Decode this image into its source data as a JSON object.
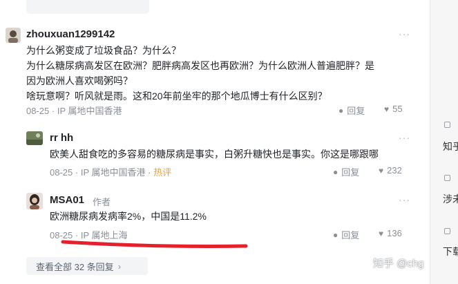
{
  "top_button": {
    "label": ""
  },
  "comments": [
    {
      "username": "zhouxuan1299142",
      "lines": [
        "为什么粥变成了垃圾食品？为什么？",
        "为什么糖尿病高发区在欧洲？肥胖病高发区也再欧洲？为什么欧洲人普遍肥胖？是",
        "因为欧洲人喜欢喝粥吗？",
        "啥玩意啊？听风就是雨。这和20年前坐牢的那个地瓜博士有什么区别？"
      ],
      "date": "08-25",
      "location": "IP 属地中国香港",
      "reply_label": "回复",
      "likes": "55"
    },
    {
      "username": "rr hh",
      "lines": [
        "欧美人甜食吃的多容易的糖尿病是事实，白粥升糖快也是事实。你这是哪跟哪"
      ],
      "date": "08-25",
      "location": "IP 属地中国香港",
      "badge": "热评",
      "reply_label": "回复",
      "likes": "232"
    },
    {
      "username": "MSA01",
      "author_tag": "作者",
      "lines": [
        "欧洲糖尿病发病率2%，中国是11.2%"
      ],
      "date": "08-25",
      "location": "IP 属地上海",
      "reply_label": "回复",
      "likes": "136"
    }
  ],
  "view_all": "查看全部 32 条回复",
  "watermark": "知乎 @chg",
  "right_panel": {
    "texts": [
      "知乎",
      "涉未",
      "下载"
    ]
  },
  "colors": {
    "hot": "#f0a030",
    "underline": "#e5202a",
    "muted": "#8a8f98"
  }
}
